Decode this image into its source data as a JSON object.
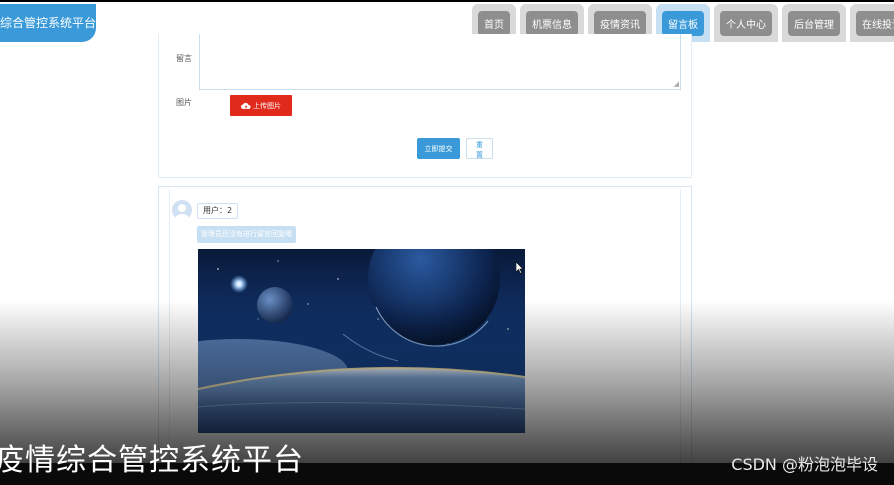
{
  "header": {
    "brand": "综合管控系统平台",
    "nav": [
      {
        "label": "首页",
        "active": false
      },
      {
        "label": "机票信息",
        "active": false
      },
      {
        "label": "疫情资讯",
        "active": false
      },
      {
        "label": "留言板",
        "active": true
      },
      {
        "label": "个人中心",
        "active": false
      },
      {
        "label": "后台管理",
        "active": false
      },
      {
        "label": "在线投诉",
        "active": false
      }
    ]
  },
  "form": {
    "message_label": "留言",
    "message_value": "",
    "image_label": "图片",
    "upload_label": "上传图片",
    "submit_label": "立即提交",
    "reset_label": "重置"
  },
  "comment": {
    "username": "用户：2",
    "reply_hint": "管理员还没有进行留言回复哦"
  },
  "overlay": {
    "caption": "疫情综合管控系统平台",
    "watermark": "CSDN @粉泡泡毕设"
  },
  "colors": {
    "accent": "#3a9ad9",
    "upload_red": "#e02a1c"
  },
  "icons": {
    "upload": "cloud-upload-icon",
    "avatar": "user-avatar-icon"
  }
}
